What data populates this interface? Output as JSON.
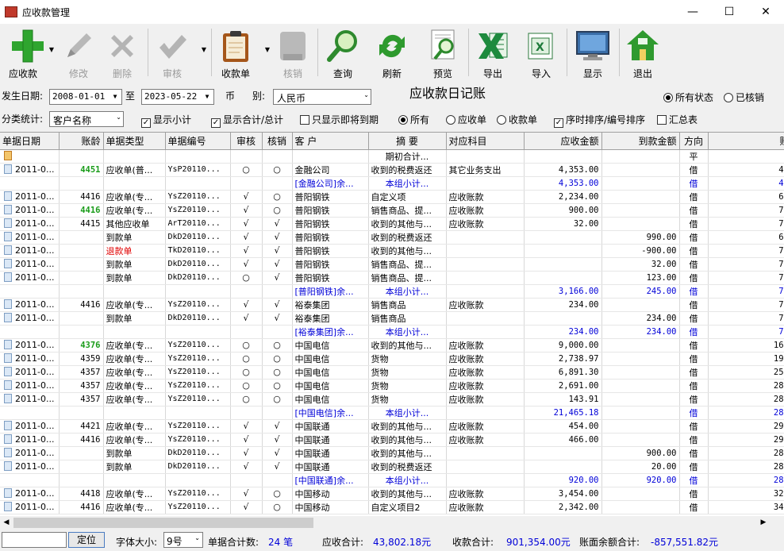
{
  "window": {
    "title": "应收款管理",
    "min": "—",
    "max": "☐",
    "close": "✕"
  },
  "toolbar": [
    {
      "key": "receivable",
      "label": "应收款",
      "icon": "plus-icon",
      "enabled": true,
      "dropdown": true
    },
    {
      "key": "edit",
      "label": "修改",
      "icon": "pencil-icon",
      "enabled": false
    },
    {
      "key": "delete",
      "label": "删除",
      "icon": "x-delete-icon",
      "enabled": false
    },
    {
      "key": "audit",
      "label": "审核",
      "icon": "checkmark-icon",
      "enabled": false,
      "dropdown": true
    },
    {
      "key": "receipt",
      "label": "收款单",
      "icon": "clipboard-icon",
      "enabled": true,
      "dropdown": true
    },
    {
      "key": "writeoff",
      "label": "核销",
      "icon": "writeoff-icon",
      "enabled": false
    },
    {
      "key": "query",
      "label": "查询",
      "icon": "magnifier-icon",
      "enabled": true
    },
    {
      "key": "refresh",
      "label": "刷新",
      "icon": "refresh-icon",
      "enabled": true
    },
    {
      "key": "preview",
      "label": "预览",
      "icon": "preview-icon",
      "enabled": true
    },
    {
      "key": "export",
      "label": "导出",
      "icon": "excel-export-icon",
      "enabled": true
    },
    {
      "key": "import",
      "label": "导入",
      "icon": "excel-import-icon",
      "enabled": true
    },
    {
      "key": "display",
      "label": "显示",
      "icon": "monitor-icon",
      "enabled": true
    },
    {
      "key": "exit",
      "label": "退出",
      "icon": "house-icon",
      "enabled": true
    }
  ],
  "filters": {
    "date_label": "发生日期:",
    "date_from": "2008-01-01",
    "to_label": "至",
    "date_to": "2023-05-22",
    "currency_label_1": "币",
    "currency_label_2": "别:",
    "currency": "人民币",
    "ledger_title": "应收款日记账",
    "status_all": "所有状态",
    "status_done": "已核销",
    "category_label": "分类统计:",
    "category": "客户名称",
    "show_subtotal": "显示小计",
    "show_total": "显示合计/总计",
    "show_due": "只显示即将到期",
    "type_all": "所有",
    "type_receivable": "应收单",
    "type_receipt": "收款单",
    "sort_label": "序时排序/编号排序",
    "summary_label": "汇总表"
  },
  "table": {
    "columns": [
      "单据日期",
      "账龄",
      "单据类型",
      "单据编号",
      "审核",
      "核销",
      "客  户",
      "摘  要",
      "对应科目",
      "应收金额",
      "到款金额",
      "方向",
      "账面"
    ],
    "rows": [
      {
        "k": "open",
        "date": "",
        "age": "",
        "type": "",
        "no": "",
        "audit": "",
        "wo": "",
        "cust": "",
        "summary": "期初合计...",
        "subject": "",
        "recv": "",
        "paid": "",
        "dir": "平",
        "bal": ""
      },
      {
        "k": "d",
        "date": "2011-0...",
        "age": "4451",
        "ageStyle": "green",
        "type": "应收单(普...",
        "no": "YsP20110...",
        "audit": "○",
        "wo": "○",
        "cust": "金融公司",
        "summary": "收到的税费返还",
        "subject": "其它业务支出",
        "recv": "4,353.00",
        "paid": "",
        "dir": "借",
        "bal": "4,35"
      },
      {
        "k": "s",
        "date": "",
        "age": "",
        "type": "",
        "no": "",
        "audit": "",
        "wo": "",
        "cust": "[金融公司]余...",
        "summary": "本组小计...",
        "subject": "",
        "recv": "4,353.00",
        "paid": "",
        "dir": "借",
        "bal": "4,35"
      },
      {
        "k": "d",
        "date": "2011-0...",
        "age": "4416",
        "type": "应收单(专...",
        "no": "YsZ20110...",
        "audit": "√",
        "wo": "○",
        "cust": "普阳钢铁",
        "summary": "自定义项",
        "subject": "应收账款",
        "recv": "2,234.00",
        "paid": "",
        "dir": "借",
        "bal": "6,58"
      },
      {
        "k": "d",
        "date": "2011-0...",
        "age": "4416",
        "ageStyle": "green",
        "type": "应收单(专...",
        "no": "YsZ20110...",
        "audit": "√",
        "wo": "○",
        "cust": "普阳钢铁",
        "summary": "销售商品、提...",
        "subject": "应收账款",
        "recv": "900.00",
        "paid": "",
        "dir": "借",
        "bal": "7,48"
      },
      {
        "k": "d",
        "date": "2011-0...",
        "age": "4415",
        "type": "其他应收单",
        "no": "ArT20110...",
        "audit": "√",
        "wo": "√",
        "cust": "普阳钢铁",
        "summary": "收到的其他与...",
        "subject": "应收账款",
        "recv": "32.00",
        "paid": "",
        "dir": "借",
        "bal": "7,51"
      },
      {
        "k": "d",
        "date": "2011-0...",
        "age": "",
        "type": "到款单",
        "no": "DkD20110...",
        "audit": "√",
        "wo": "√",
        "cust": "普阳钢铁",
        "summary": "收到的税费返还",
        "subject": "",
        "recv": "",
        "paid": "990.00",
        "dir": "借",
        "bal": "6,52"
      },
      {
        "k": "d",
        "date": "2011-0...",
        "age": "",
        "type": "退款单",
        "typeStyle": "red",
        "no": "TkD20110...",
        "audit": "√",
        "wo": "√",
        "cust": "普阳钢铁",
        "summary": "收到的其他与...",
        "subject": "",
        "recv": "",
        "paid": "-900.00",
        "dir": "借",
        "bal": "7,42"
      },
      {
        "k": "d",
        "date": "2011-0...",
        "age": "",
        "type": "到款单",
        "no": "DkD20110...",
        "audit": "√",
        "wo": "√",
        "cust": "普阳钢铁",
        "summary": "销售商品、提...",
        "subject": "",
        "recv": "",
        "paid": "32.00",
        "dir": "借",
        "bal": "7,39"
      },
      {
        "k": "d",
        "date": "2011-0...",
        "age": "",
        "type": "到款单",
        "no": "DkD20110...",
        "audit": "○",
        "wo": "√",
        "cust": "普阳钢铁",
        "summary": "销售商品、提...",
        "subject": "",
        "recv": "",
        "paid": "123.00",
        "dir": "借",
        "bal": "7,27"
      },
      {
        "k": "s",
        "date": "",
        "age": "",
        "type": "",
        "no": "",
        "audit": "",
        "wo": "",
        "cust": "[普阳钢铁]余...",
        "summary": "本组小计...",
        "subject": "",
        "recv": "3,166.00",
        "paid": "245.00",
        "dir": "借",
        "bal": "7,27"
      },
      {
        "k": "d",
        "date": "2011-0...",
        "age": "4416",
        "type": "应收单(专...",
        "no": "YsZ20110...",
        "audit": "√",
        "wo": "√",
        "cust": "裕泰集团",
        "summary": "销售商品",
        "subject": "应收账款",
        "recv": "234.00",
        "paid": "",
        "dir": "借",
        "bal": "7,50"
      },
      {
        "k": "d",
        "date": "2011-0...",
        "age": "",
        "type": "到款单",
        "no": "DkD20110...",
        "audit": "√",
        "wo": "√",
        "cust": "裕泰集团",
        "summary": "销售商品",
        "subject": "",
        "recv": "",
        "paid": "234.00",
        "dir": "借",
        "bal": "7,27"
      },
      {
        "k": "s",
        "date": "",
        "age": "",
        "type": "",
        "no": "",
        "audit": "",
        "wo": "",
        "cust": "[裕泰集团]余...",
        "summary": "本组小计...",
        "subject": "",
        "recv": "234.00",
        "paid": "234.00",
        "dir": "借",
        "bal": "7,27"
      },
      {
        "k": "d",
        "date": "2011-0...",
        "age": "4376",
        "ageStyle": "green",
        "type": "应收单(专...",
        "no": "YsZ20110...",
        "audit": "○",
        "wo": "○",
        "cust": "中国电信",
        "summary": "收到的其他与...",
        "subject": "应收账款",
        "recv": "9,000.00",
        "paid": "",
        "dir": "借",
        "bal": "16,27"
      },
      {
        "k": "d",
        "date": "2011-0...",
        "age": "4359",
        "type": "应收单(专...",
        "no": "YsZ20110...",
        "audit": "○",
        "wo": "○",
        "cust": "中国电信",
        "summary": "货物",
        "subject": "应收账款",
        "recv": "2,738.97",
        "paid": "",
        "dir": "借",
        "bal": "19,01"
      },
      {
        "k": "d",
        "date": "2011-0...",
        "age": "4357",
        "type": "应收单(专...",
        "no": "YsZ20110...",
        "audit": "○",
        "wo": "○",
        "cust": "中国电信",
        "summary": "货物",
        "subject": "应收账款",
        "recv": "6,891.30",
        "paid": "",
        "dir": "借",
        "bal": "25,90"
      },
      {
        "k": "d",
        "date": "2011-0...",
        "age": "4357",
        "type": "应收单(专...",
        "no": "YsZ20110...",
        "audit": "○",
        "wo": "○",
        "cust": "中国电信",
        "summary": "货物",
        "subject": "应收账款",
        "recv": "2,691.00",
        "paid": "",
        "dir": "借",
        "bal": "28,59"
      },
      {
        "k": "d",
        "date": "2011-0...",
        "age": "4357",
        "type": "应收单(专...",
        "no": "YsZ20110...",
        "audit": "○",
        "wo": "○",
        "cust": "中国电信",
        "summary": "货物",
        "subject": "应收账款",
        "recv": "143.91",
        "paid": "",
        "dir": "借",
        "bal": "28,73"
      },
      {
        "k": "s",
        "date": "",
        "age": "",
        "type": "",
        "no": "",
        "audit": "",
        "wo": "",
        "cust": "[中国电信]余...",
        "summary": "本组小计...",
        "subject": "",
        "recv": "21,465.18",
        "paid": "",
        "dir": "借",
        "bal": "28,73"
      },
      {
        "k": "d",
        "date": "2011-0...",
        "age": "4421",
        "type": "应收单(专...",
        "no": "YsZ20110...",
        "audit": "√",
        "wo": "√",
        "cust": "中国联通",
        "summary": "收到的其他与...",
        "subject": "应收账款",
        "recv": "454.00",
        "paid": "",
        "dir": "借",
        "bal": "29,19"
      },
      {
        "k": "d",
        "date": "2011-0...",
        "age": "4416",
        "type": "应收单(专...",
        "no": "YsZ20110...",
        "audit": "√",
        "wo": "√",
        "cust": "中国联通",
        "summary": "收到的其他与...",
        "subject": "应收账款",
        "recv": "466.00",
        "paid": "",
        "dir": "借",
        "bal": "29,65"
      },
      {
        "k": "d",
        "date": "2011-0...",
        "age": "",
        "type": "到款单",
        "no": "DkD20110...",
        "audit": "√",
        "wo": "√",
        "cust": "中国联通",
        "summary": "收到的其他与...",
        "subject": "",
        "recv": "",
        "paid": "900.00",
        "dir": "借",
        "bal": "28,75"
      },
      {
        "k": "d",
        "date": "2011-0...",
        "age": "",
        "type": "到款单",
        "no": "DkD20110...",
        "audit": "√",
        "wo": "√",
        "cust": "中国联通",
        "summary": "收到的税费返还",
        "subject": "",
        "recv": "",
        "paid": "20.00",
        "dir": "借",
        "bal": "28,73"
      },
      {
        "k": "s",
        "date": "",
        "age": "",
        "type": "",
        "no": "",
        "audit": "",
        "wo": "",
        "cust": "[中国联通]余...",
        "summary": "本组小计...",
        "subject": "",
        "recv": "920.00",
        "paid": "920.00",
        "dir": "借",
        "bal": "28,73"
      },
      {
        "k": "d",
        "date": "2011-0...",
        "age": "4418",
        "type": "应收单(专...",
        "no": "YsZ20110...",
        "audit": "√",
        "wo": "○",
        "cust": "中国移动",
        "summary": "收到的其他与...",
        "subject": "应收账款",
        "recv": "3,454.00",
        "paid": "",
        "dir": "借",
        "bal": "32,19"
      },
      {
        "k": "d",
        "date": "2011-0...",
        "age": "4416",
        "type": "应收单(专...",
        "no": "YsZ20110...",
        "audit": "√",
        "wo": "○",
        "cust": "中国移动",
        "summary": "自定义项目2",
        "subject": "应收账款",
        "recv": "2,342.00",
        "paid": "",
        "dir": "借",
        "bal": "34,53"
      }
    ]
  },
  "statusbar": {
    "locate_value": "",
    "locate_button": "定位",
    "font_size_label": "字体大小:",
    "font_size": "9号",
    "doc_count_label": "单据合计数:",
    "doc_count": "24 笔",
    "recv_total_label": "应收合计:",
    "recv_total": "43,802.18元",
    "paid_total_label": "收款合计:",
    "paid_total": "901,354.00元",
    "balance_total_label": "账面余额合计:",
    "balance_total": "-857,551.82元"
  }
}
